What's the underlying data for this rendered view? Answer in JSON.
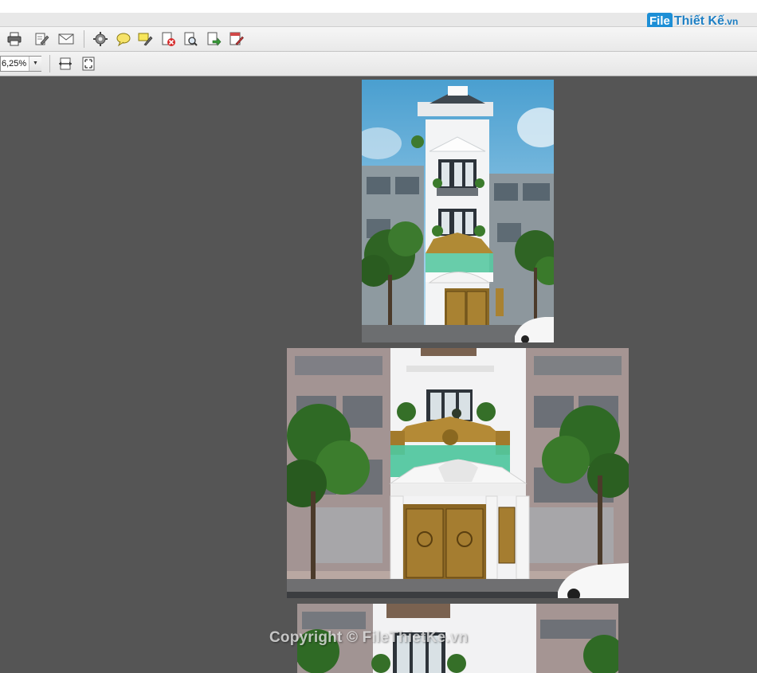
{
  "toolbar": {
    "icons": [
      "printer-icon",
      "edit-document-icon",
      "email-icon",
      "settings-icon",
      "comment-icon",
      "highlight-icon",
      "delete-file-icon",
      "search-document-icon",
      "export-icon",
      "sign-document-icon"
    ]
  },
  "view_toolbar": {
    "zoom_value": "6,25%",
    "icons": [
      "fit-width-icon",
      "fit-page-icon"
    ]
  },
  "logo": {
    "brand_box": "File",
    "brand_rest": "Thiết Kế",
    "brand_tld": ".vn"
  },
  "document": {
    "pages": [
      "page-1",
      "page-2",
      "page-3"
    ],
    "watermark": "Copyright © FileThietKe.vn"
  },
  "colors": {
    "workspace": "#555555",
    "toolbar": "#ececec",
    "brand": "#1d8fd6"
  }
}
